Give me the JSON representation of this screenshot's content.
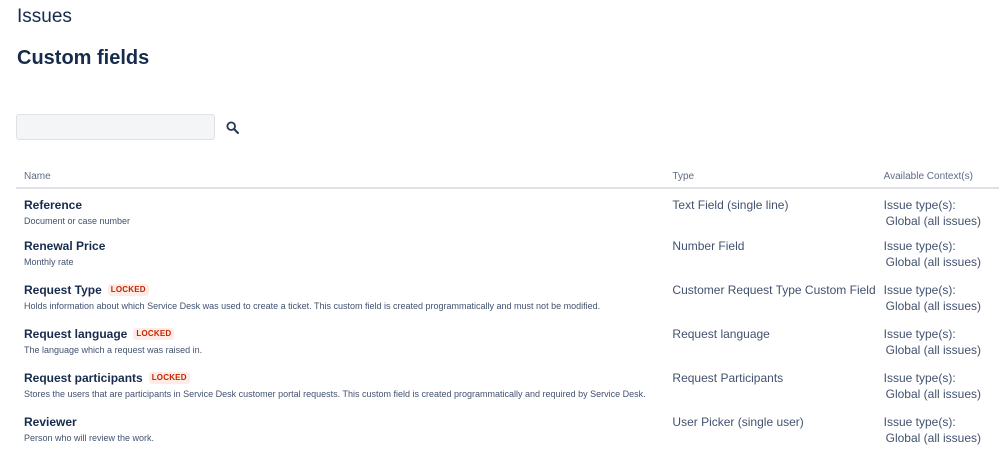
{
  "header": {
    "section_title": "Issues",
    "page_title": "Custom fields"
  },
  "search": {
    "value": "",
    "placeholder": "",
    "button_icon": "search-icon"
  },
  "table": {
    "columns": [
      "Name",
      "Type",
      "Available Context(s)"
    ],
    "rows": [
      {
        "name": "Reference",
        "locked": "",
        "description": "Document or case number",
        "type": "Text Field (single line)",
        "context_label": "Issue type(s):",
        "context_value": "Global (all issues)"
      },
      {
        "name": "Renewal Price",
        "locked": "",
        "description": "Monthly rate",
        "type": "Number Field",
        "context_label": "Issue type(s):",
        "context_value": "Global (all issues)"
      },
      {
        "name": "Request Type",
        "locked": "LOCKED",
        "description": "Holds information about which Service Desk was used to create a ticket. This custom field is created programmatically and must not be modified.",
        "type": "Customer Request Type Custom Field",
        "context_label": "Issue type(s):",
        "context_value": "Global (all issues)"
      },
      {
        "name": "Request language",
        "locked": "LOCKED",
        "description": "The language which a request was raised in.",
        "type": "Request language",
        "context_label": "Issue type(s):",
        "context_value": "Global (all issues)"
      },
      {
        "name": "Request participants",
        "locked": "LOCKED",
        "description": "Stores the users that are participants in Service Desk customer portal requests. This custom field is created programmatically and required by Service Desk.",
        "type": "Request Participants",
        "context_label": "Issue type(s):",
        "context_value": "Global (all issues)"
      },
      {
        "name": "Reviewer",
        "locked": "",
        "description": "Person who will review the work.",
        "type": "User Picker (single user)",
        "context_label": "Issue type(s):",
        "context_value": "Global (all issues)"
      }
    ]
  },
  "colors": {
    "heading": "#172b4d",
    "muted": "#42526e",
    "locked_text": "#bf2600",
    "locked_bg": "#ffebe6",
    "border": "#dfe1e6"
  }
}
